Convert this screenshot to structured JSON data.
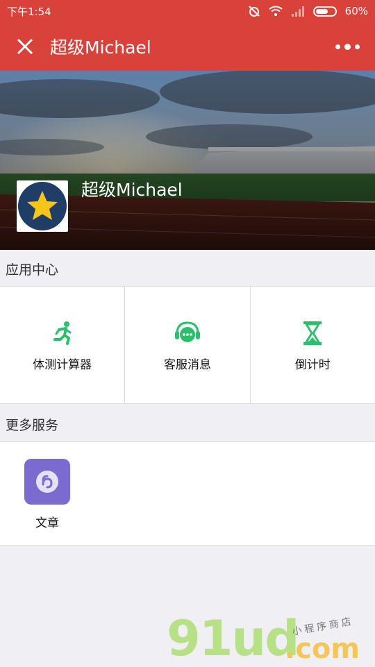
{
  "status_bar": {
    "time": "下午1:54",
    "battery": "60%"
  },
  "nav": {
    "title": "超级Michael"
  },
  "banner": {
    "name": "超级Michael"
  },
  "sections": {
    "app_center": "应用中心",
    "more_services": "更多服务"
  },
  "apps": [
    {
      "label": "体测计算器",
      "icon": "running-person-icon"
    },
    {
      "label": "客服消息",
      "icon": "customer-service-headset-icon"
    },
    {
      "label": "倒计时",
      "icon": "hourglass-icon"
    }
  ],
  "services": [
    {
      "label": "文章",
      "icon": "mini-program-icon"
    }
  ],
  "watermark": {
    "logo": "91ud",
    "domain": ".com",
    "tagline": "小程序商店"
  },
  "colors": {
    "header": "#d9423a",
    "app_icon_green": "#2bbf6b",
    "service_icon_purple": "#7b6bd0"
  }
}
